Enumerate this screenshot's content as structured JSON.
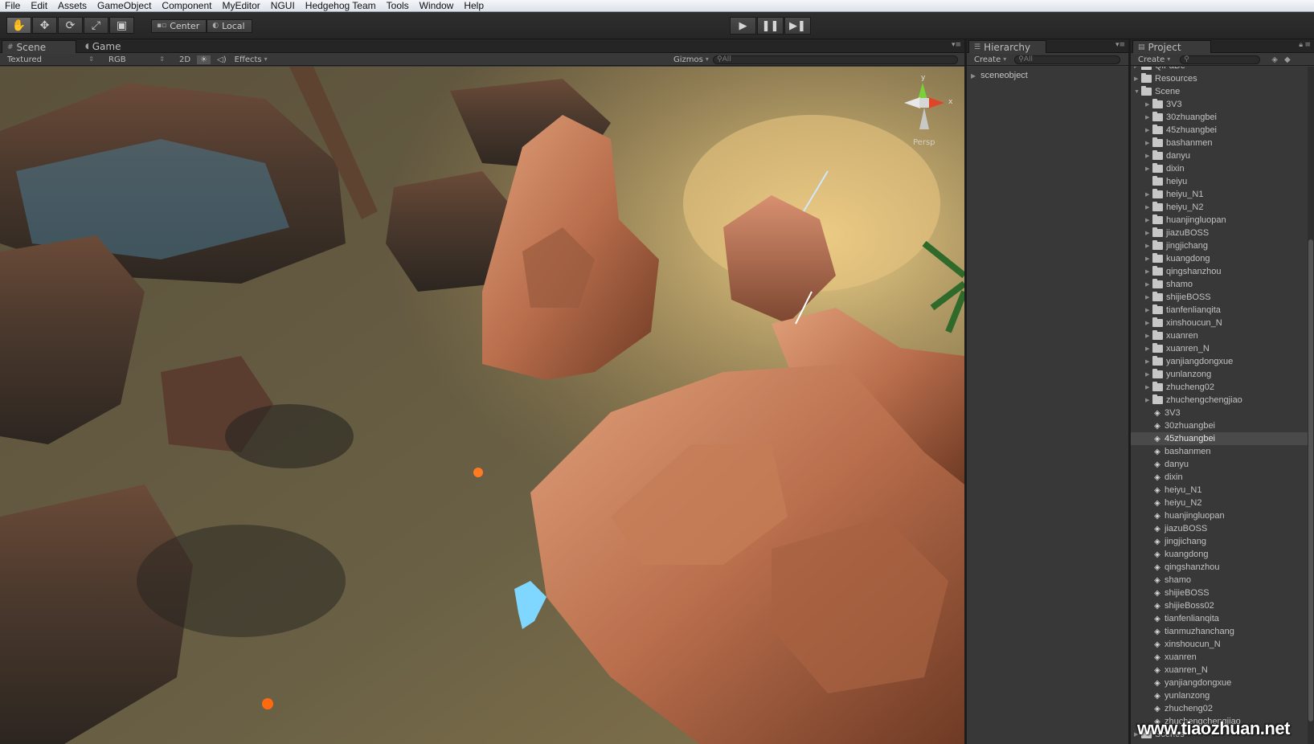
{
  "menu": [
    "File",
    "Edit",
    "Assets",
    "GameObject",
    "Component",
    "MyEditor",
    "NGUI",
    "Hedgehog Team",
    "Tools",
    "Window",
    "Help"
  ],
  "toolbar": {
    "tools": [
      "hand-icon",
      "move-icon",
      "rotate-icon",
      "scale-icon",
      "rect-icon"
    ],
    "pivot": "Center",
    "space": "Local",
    "play": [
      "play-icon",
      "pause-icon",
      "step-icon"
    ]
  },
  "scene_panel": {
    "tabs": [
      "Scene",
      "Game"
    ],
    "render_mode": "Textured",
    "color_mode": "RGB",
    "mode_2d": "2D",
    "effects": "Effects",
    "gizmos": "Gizmos",
    "search_placeholder": "All",
    "gizmo_axes": {
      "y": "y",
      "x": "x"
    },
    "projection_label": "Persp"
  },
  "hierarchy": {
    "title": "Hierarchy",
    "create": "Create",
    "search_placeholder": "All",
    "items": [
      "sceneobject"
    ]
  },
  "project": {
    "title": "Project",
    "create": "Create",
    "tree": [
      {
        "label": "QiFaDe",
        "type": "folder",
        "depth": 0,
        "arrow": "right"
      },
      {
        "label": "Resources",
        "type": "folder",
        "depth": 0,
        "arrow": "right"
      },
      {
        "label": "Scene",
        "type": "folder",
        "depth": 0,
        "arrow": "down"
      },
      {
        "label": "3V3",
        "type": "folder",
        "depth": 1,
        "arrow": "right"
      },
      {
        "label": "30zhuangbei",
        "type": "folder",
        "depth": 1,
        "arrow": "right"
      },
      {
        "label": "45zhuangbei",
        "type": "folder",
        "depth": 1,
        "arrow": "right"
      },
      {
        "label": "bashanmen",
        "type": "folder",
        "depth": 1,
        "arrow": "right"
      },
      {
        "label": "danyu",
        "type": "folder",
        "depth": 1,
        "arrow": "right"
      },
      {
        "label": "dixin",
        "type": "folder",
        "depth": 1,
        "arrow": "right"
      },
      {
        "label": "heiyu",
        "type": "folder",
        "depth": 1,
        "arrow": ""
      },
      {
        "label": "heiyu_N1",
        "type": "folder",
        "depth": 1,
        "arrow": "right"
      },
      {
        "label": "heiyu_N2",
        "type": "folder",
        "depth": 1,
        "arrow": "right"
      },
      {
        "label": "huanjingluopan",
        "type": "folder",
        "depth": 1,
        "arrow": "right"
      },
      {
        "label": "jiazuBOSS",
        "type": "folder",
        "depth": 1,
        "arrow": "right"
      },
      {
        "label": "jingjichang",
        "type": "folder",
        "depth": 1,
        "arrow": "right"
      },
      {
        "label": "kuangdong",
        "type": "folder",
        "depth": 1,
        "arrow": "right"
      },
      {
        "label": "qingshanzhou",
        "type": "folder",
        "depth": 1,
        "arrow": "right"
      },
      {
        "label": "shamo",
        "type": "folder",
        "depth": 1,
        "arrow": "right"
      },
      {
        "label": "shijieBOSS",
        "type": "folder",
        "depth": 1,
        "arrow": "right"
      },
      {
        "label": "tianfenlianqita",
        "type": "folder",
        "depth": 1,
        "arrow": "right"
      },
      {
        "label": "xinshoucun_N",
        "type": "folder",
        "depth": 1,
        "arrow": "right"
      },
      {
        "label": "xuanren",
        "type": "folder",
        "depth": 1,
        "arrow": "right"
      },
      {
        "label": "xuanren_N",
        "type": "folder",
        "depth": 1,
        "arrow": "right"
      },
      {
        "label": "yanjiangdongxue",
        "type": "folder",
        "depth": 1,
        "arrow": "right"
      },
      {
        "label": "yunlanzong",
        "type": "folder",
        "depth": 1,
        "arrow": "right"
      },
      {
        "label": "zhucheng02",
        "type": "folder",
        "depth": 1,
        "arrow": "right"
      },
      {
        "label": "zhuchengchengjiao",
        "type": "folder",
        "depth": 1,
        "arrow": "right"
      },
      {
        "label": "3V3",
        "type": "scene",
        "depth": 1,
        "arrow": ""
      },
      {
        "label": "30zhuangbei",
        "type": "scene",
        "depth": 1,
        "arrow": ""
      },
      {
        "label": "45zhuangbei",
        "type": "scene",
        "depth": 1,
        "arrow": "",
        "selected": true
      },
      {
        "label": "bashanmen",
        "type": "scene",
        "depth": 1,
        "arrow": ""
      },
      {
        "label": "danyu",
        "type": "scene",
        "depth": 1,
        "arrow": ""
      },
      {
        "label": "dixin",
        "type": "scene",
        "depth": 1,
        "arrow": ""
      },
      {
        "label": "heiyu_N1",
        "type": "scene",
        "depth": 1,
        "arrow": ""
      },
      {
        "label": "heiyu_N2",
        "type": "scene",
        "depth": 1,
        "arrow": ""
      },
      {
        "label": "huanjingluopan",
        "type": "scene",
        "depth": 1,
        "arrow": ""
      },
      {
        "label": "jiazuBOSS",
        "type": "scene",
        "depth": 1,
        "arrow": ""
      },
      {
        "label": "jingjichang",
        "type": "scene",
        "depth": 1,
        "arrow": ""
      },
      {
        "label": "kuangdong",
        "type": "scene",
        "depth": 1,
        "arrow": ""
      },
      {
        "label": "qingshanzhou",
        "type": "scene",
        "depth": 1,
        "arrow": ""
      },
      {
        "label": "shamo",
        "type": "scene",
        "depth": 1,
        "arrow": ""
      },
      {
        "label": "shijieBOSS",
        "type": "scene",
        "depth": 1,
        "arrow": ""
      },
      {
        "label": "shijieBoss02",
        "type": "scene",
        "depth": 1,
        "arrow": ""
      },
      {
        "label": "tianfenlianqita",
        "type": "scene",
        "depth": 1,
        "arrow": ""
      },
      {
        "label": "tianmuzhanchang",
        "type": "scene",
        "depth": 1,
        "arrow": ""
      },
      {
        "label": "xinshoucun_N",
        "type": "scene",
        "depth": 1,
        "arrow": ""
      },
      {
        "label": "xuanren",
        "type": "scene",
        "depth": 1,
        "arrow": ""
      },
      {
        "label": "xuanren_N",
        "type": "scene",
        "depth": 1,
        "arrow": ""
      },
      {
        "label": "yanjiangdongxue",
        "type": "scene",
        "depth": 1,
        "arrow": ""
      },
      {
        "label": "yunlanzong",
        "type": "scene",
        "depth": 1,
        "arrow": ""
      },
      {
        "label": "zhucheng02",
        "type": "scene",
        "depth": 1,
        "arrow": ""
      },
      {
        "label": "zhuchengchengjiao",
        "type": "scene",
        "depth": 1,
        "arrow": ""
      },
      {
        "label": "Scenes",
        "type": "folder",
        "depth": 0,
        "arrow": "right"
      }
    ]
  },
  "watermark": "www.tiaozhuan.net",
  "colors": {
    "selected_row": "#4a4a4a",
    "panel_bg": "#383838",
    "toolbar_bg": "#2a2a2a"
  }
}
